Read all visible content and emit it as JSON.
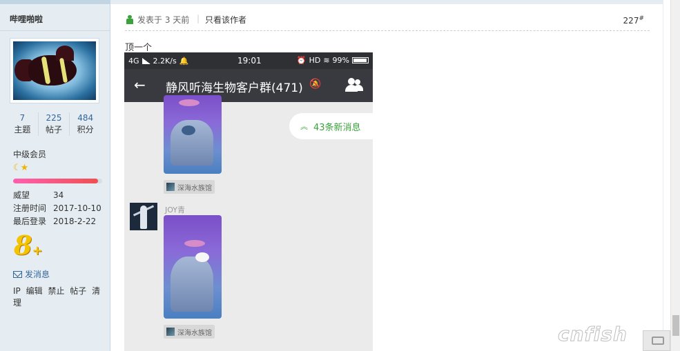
{
  "author": {
    "username": "哔哩啪啦",
    "stats": [
      {
        "value": "7",
        "label": "主题"
      },
      {
        "value": "225",
        "label": "帖子"
      },
      {
        "value": "484",
        "label": "积分"
      }
    ],
    "level": "中级会员",
    "credit_progress": 0.95,
    "info": [
      {
        "key": "威望",
        "value": "34"
      },
      {
        "key": "注册时间",
        "value": "2017-10-10"
      },
      {
        "key": "最后登录",
        "value": "2018-2-22"
      }
    ],
    "badge": "8",
    "send_message": "发消息",
    "admin_actions": [
      "IP",
      "编辑",
      "禁止",
      "帖子",
      "清理"
    ]
  },
  "post": {
    "time": "发表于 3 天前",
    "separator": "|",
    "author_only": "只看该作者",
    "floor": "227",
    "floor_mark": "#",
    "text": "顶一个"
  },
  "phone": {
    "status_left": "4G",
    "status_speed": "2.2K/s",
    "status_time": "19:01",
    "status_hd": "HD",
    "status_battery": "99%",
    "group_title": "静风听海生物客户群(471)",
    "new_messages": "43条新消息",
    "source_tag": "深海水族馆",
    "sender": "JOY青"
  },
  "watermark": "cnfish",
  "colors": {
    "sidebar_bg": "#e5edf2",
    "link": "#336699",
    "accent_green": "#3aa23a",
    "chat_header": "#393a3f"
  }
}
